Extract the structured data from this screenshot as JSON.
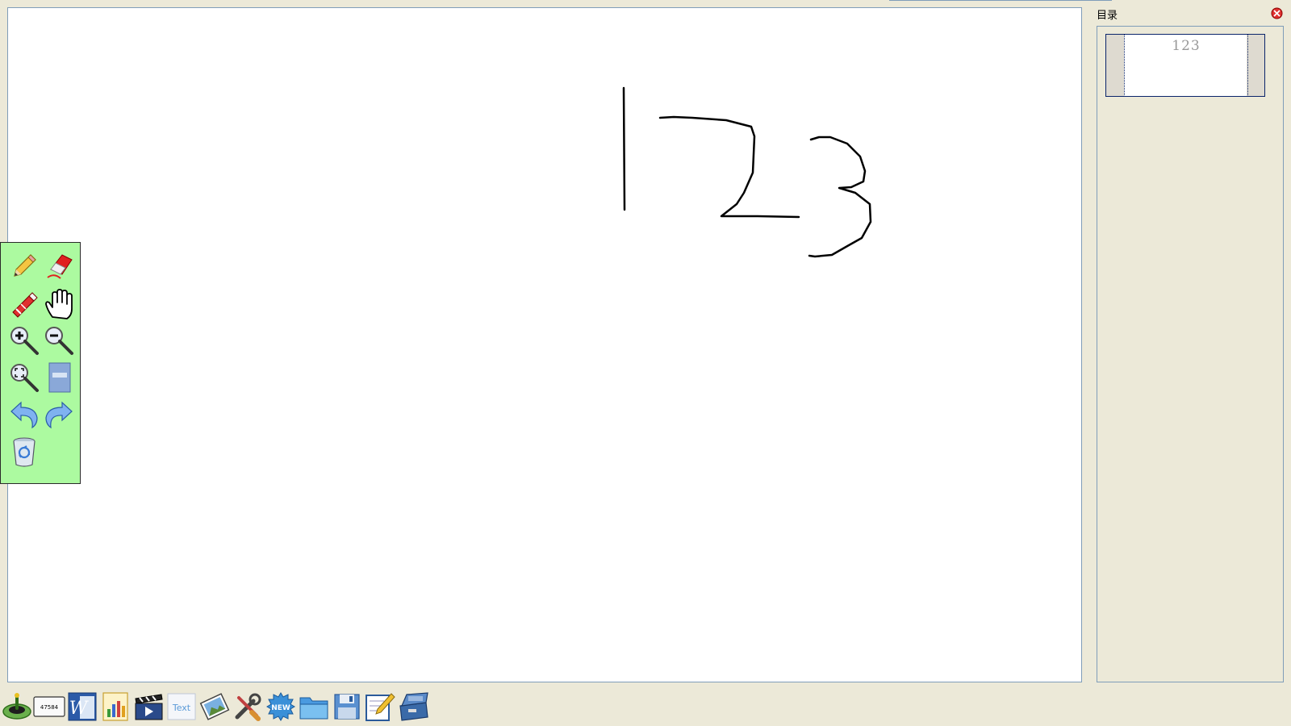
{
  "sidebar": {
    "title": "目录",
    "thumbnail": {
      "preview_text": "123"
    }
  },
  "whiteboard": {
    "drawing_content": "123"
  },
  "toolbox": {
    "tools": [
      "pencil-icon",
      "eraser-icon",
      "highlighter-icon",
      "hand-pan-icon",
      "zoom-in-icon",
      "zoom-out-icon",
      "zoom-fit-icon",
      "page-icon",
      "undo-icon",
      "redo-icon",
      "recycle-bin-icon"
    ]
  },
  "taskbar": {
    "buttons": [
      {
        "name": "start-icon"
      },
      {
        "name": "keyboard-icon",
        "label": "47584"
      },
      {
        "name": "word-icon",
        "label": "W"
      },
      {
        "name": "chart-icon"
      },
      {
        "name": "video-icon"
      },
      {
        "name": "text-icon",
        "label": "Text"
      },
      {
        "name": "image-icon"
      },
      {
        "name": "tools-icon"
      },
      {
        "name": "new-badge-icon",
        "label": "NEW"
      },
      {
        "name": "folder-icon"
      },
      {
        "name": "save-icon"
      },
      {
        "name": "edit-icon"
      },
      {
        "name": "toolbox-icon"
      }
    ]
  },
  "colors": {
    "background": "#ece9d8",
    "toolbox_bg": "#acfaa0",
    "border": "#7f9db9",
    "ink": "#000000",
    "close_red": "#e03030"
  }
}
